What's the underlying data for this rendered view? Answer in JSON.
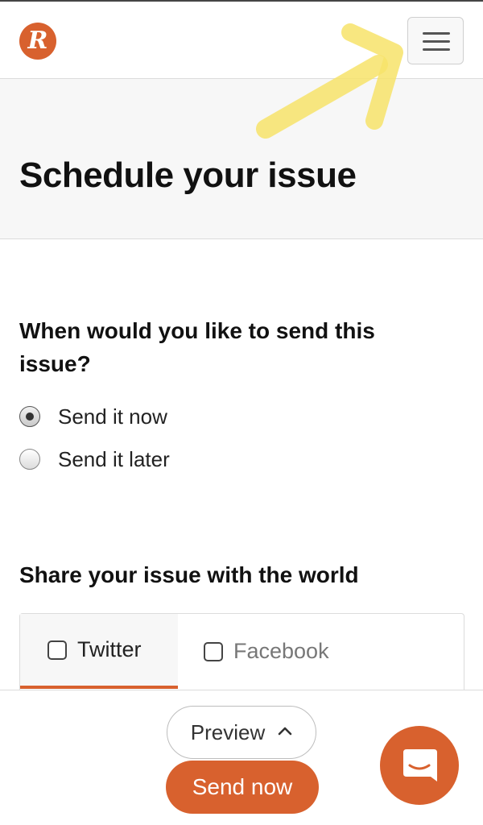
{
  "header": {
    "logo_letter": "R",
    "logo_icon": "brand-logo",
    "menu_icon": "hamburger-icon",
    "accent_color": "#d8612e"
  },
  "hero": {
    "title": "Schedule your issue"
  },
  "schedule": {
    "question": "When would you like to send this issue?",
    "options": [
      {
        "label": "Send it now",
        "selected": true
      },
      {
        "label": "Send it later",
        "selected": false
      }
    ]
  },
  "share": {
    "title": "Share your issue with the world",
    "tabs": [
      {
        "label": "Twitter",
        "active": true,
        "checked": false
      },
      {
        "label": "Facebook",
        "active": false,
        "checked": false
      }
    ]
  },
  "footer": {
    "preview_label": "Preview",
    "send_label": "Send now",
    "chat_icon": "chat-icon"
  }
}
